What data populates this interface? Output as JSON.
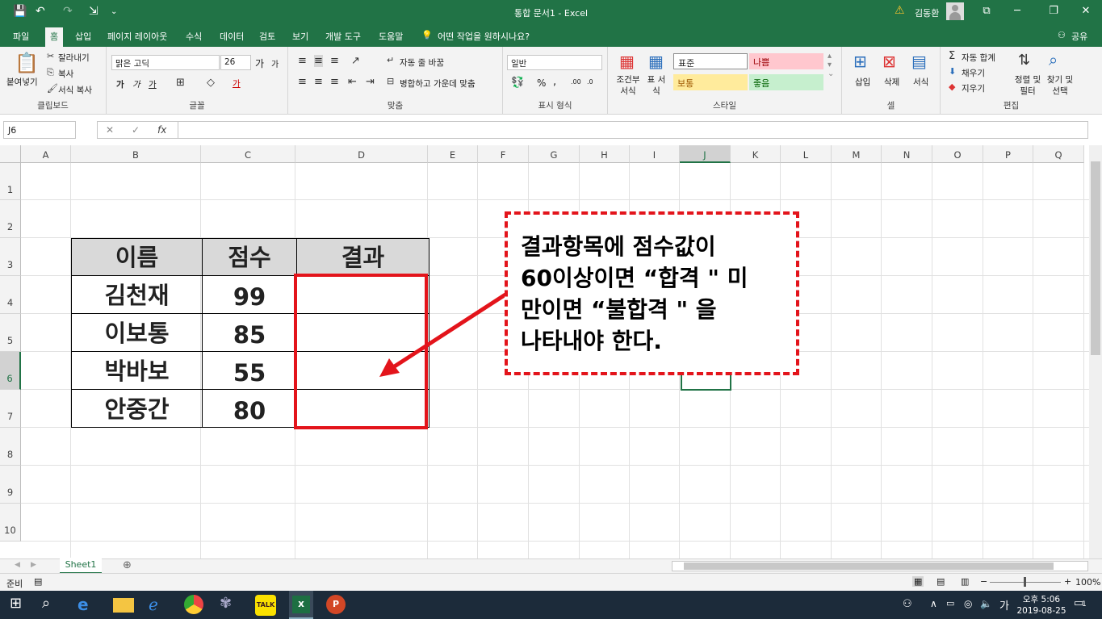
{
  "titlebar": {
    "title": "통합 문서1 - Excel",
    "user": "김동환",
    "qa": [
      "💾",
      "↶",
      "↷",
      "⇲",
      "⌄"
    ],
    "win": [
      "⧉",
      "─",
      "❐",
      "✕"
    ]
  },
  "menu": {
    "tabs": [
      "파일",
      "홈",
      "삽입",
      "페이지 레이아웃",
      "수식",
      "데이터",
      "검토",
      "보기",
      "개발 도구",
      "도움말"
    ],
    "tell": "어떤 작업을 원하시나요?",
    "share": "공유"
  },
  "ribbon": {
    "clipboard": {
      "paste": "붙여넣기",
      "cut": "잘라내기",
      "copy": "복사",
      "format": "서식 복사",
      "label": "클립보드"
    },
    "font": {
      "name": "맑은 고딕",
      "size": "26",
      "bold": "가",
      "italic": "가",
      "underline": "가",
      "grow": "가",
      "shrink": "가",
      "color": "가",
      "label": "글꼴"
    },
    "align": {
      "wrap": "자동 줄 바꿈",
      "merge": "병합하고 가운데 맞춤",
      "label": "맞춤"
    },
    "number": {
      "format": "일반",
      "pct": "%",
      "comma": ",",
      "label": "표시 형식"
    },
    "styles": {
      "cond": "조건부 서식",
      "table": "표 서식",
      "normal": "표준",
      "bad": "나쁨",
      "neutral": "보통",
      "good": "좋음",
      "label": "스타일"
    },
    "cells": {
      "insert": "삽입",
      "delete": "삭제",
      "format": "서식",
      "label": "셀"
    },
    "editing": {
      "autosum": "자동 합계",
      "fill": "채우기",
      "clear": "지우기",
      "sort": "정렬 및 필터",
      "find": "찾기 및 선택",
      "label": "편집"
    }
  },
  "formula": {
    "namebox": "J6",
    "fx": "fx",
    "cancel": "✕",
    "enter": "✓"
  },
  "grid": {
    "columns": [
      "A",
      "B",
      "C",
      "D",
      "E",
      "F",
      "G",
      "H",
      "I",
      "J",
      "K",
      "L",
      "M",
      "N",
      "O",
      "P",
      "Q"
    ],
    "rows": [
      "1",
      "2",
      "3",
      "4",
      "5",
      "6",
      "7",
      "8",
      "9",
      "10"
    ],
    "selected_col": "J"
  },
  "table": {
    "header": [
      "이름",
      "점수",
      "결과"
    ],
    "rows": [
      [
        "김천재",
        "99",
        ""
      ],
      [
        "이보통",
        "85",
        ""
      ],
      [
        "박바보",
        "55",
        ""
      ],
      [
        "안중간",
        "80",
        ""
      ]
    ]
  },
  "callout": {
    "lines": [
      "결과항목에 점수값이",
      "60이상이면 “합격 \" 미",
      "만이면 “불합격 \" 을",
      "나타내야 한다."
    ]
  },
  "sheet": {
    "name": "Sheet1",
    "add": "⊕"
  },
  "status": {
    "ready": "준비",
    "zoom": "100%"
  },
  "taskbar": {
    "time": "오후 5:06",
    "date": "2019-08-25",
    "ime": "가",
    "notif": "1"
  }
}
